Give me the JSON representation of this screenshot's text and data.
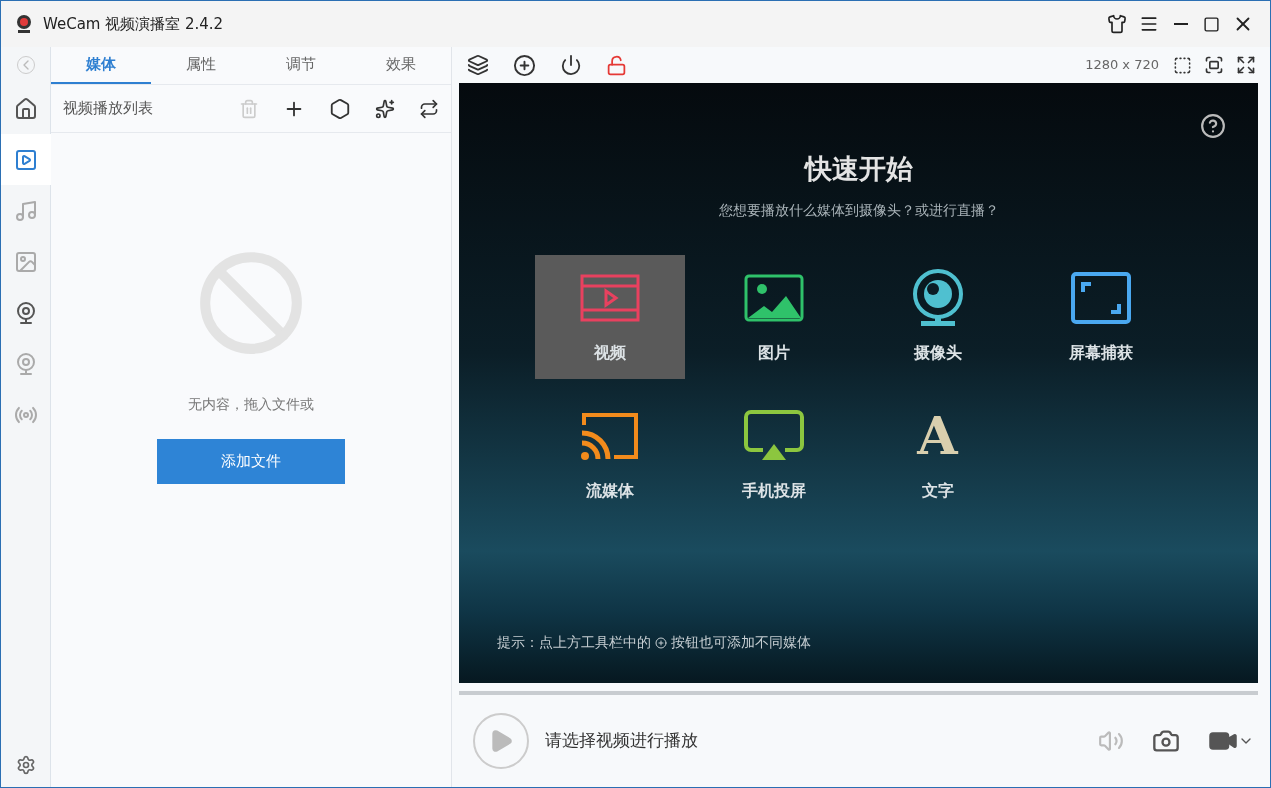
{
  "window": {
    "title": "WeCam 视频演播室 2.4.2"
  },
  "sidebar": {
    "items": [
      {
        "kind": "home",
        "selected": false
      },
      {
        "kind": "video",
        "selected": true
      },
      {
        "kind": "music",
        "selected": false
      },
      {
        "kind": "image",
        "selected": false
      },
      {
        "kind": "camera",
        "selected": false
      },
      {
        "kind": "webcam",
        "selected": false
      },
      {
        "kind": "broadcast",
        "selected": false
      }
    ]
  },
  "tabs": [
    {
      "label": "媒体",
      "selected": true
    },
    {
      "label": "属性",
      "selected": false
    },
    {
      "label": "调节",
      "selected": false
    },
    {
      "label": "效果",
      "selected": false
    }
  ],
  "playlist": {
    "title": "视频播放列表",
    "delete_disabled": true,
    "empty_text": "无内容，拖入文件或",
    "add_button": "添加文件"
  },
  "toolbar": {
    "resolution": "1280 x 720"
  },
  "quick_start": {
    "title": "快速开始",
    "subtitle": "您想要播放什么媒体到摄像头？或进行直播？",
    "items": [
      {
        "kind": "video",
        "label": "视频",
        "selected": true
      },
      {
        "kind": "image",
        "label": "图片",
        "selected": false
      },
      {
        "kind": "camera",
        "label": "摄像头",
        "selected": false
      },
      {
        "kind": "screen",
        "label": "屏幕捕获",
        "selected": false
      },
      {
        "kind": "stream",
        "label": "流媒体",
        "selected": false
      },
      {
        "kind": "mirror",
        "label": "手机投屏",
        "selected": false
      },
      {
        "kind": "text",
        "label": "文字",
        "selected": false,
        "glyph": "A"
      }
    ],
    "hint_before": "提示：点上方工具栏中的",
    "hint_after": "按钮也可添加不同媒体"
  },
  "player": {
    "status": "请选择视频进行播放",
    "level": 0
  }
}
